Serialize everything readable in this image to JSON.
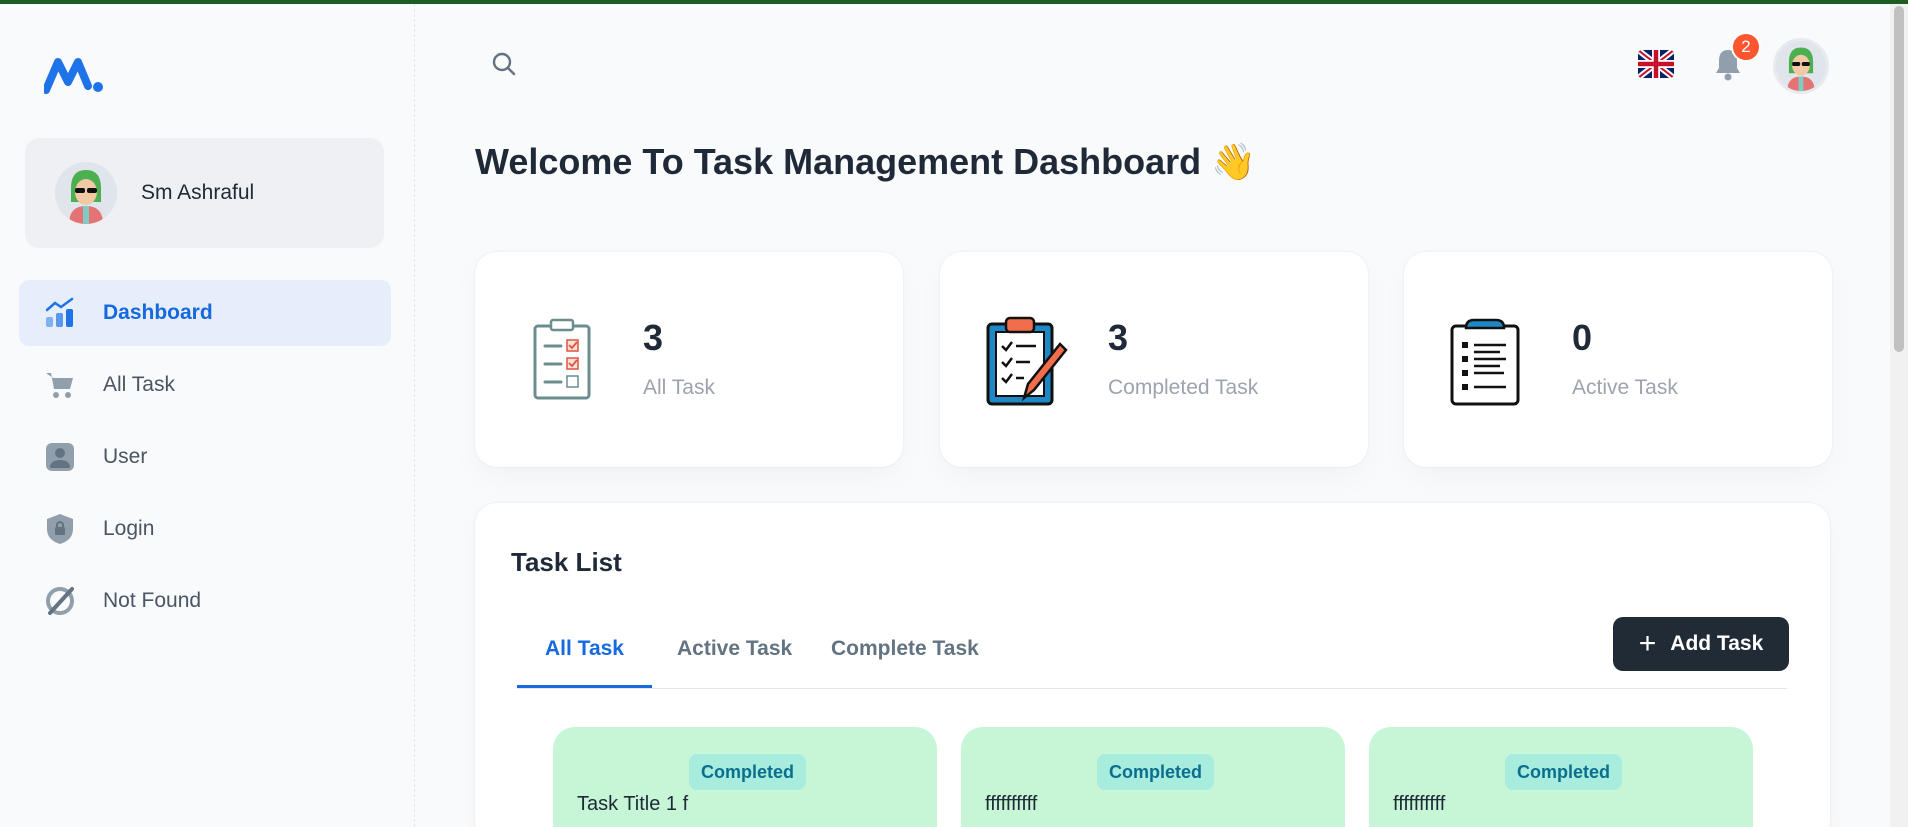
{
  "sidebar": {
    "user_name": "Sm Ashraful",
    "items": [
      {
        "label": "Dashboard",
        "icon": "chart-icon"
      },
      {
        "label": "All Task",
        "icon": "cart-icon"
      },
      {
        "label": "User",
        "icon": "user-icon"
      },
      {
        "label": "Login",
        "icon": "lock-icon"
      },
      {
        "label": "Not Found",
        "icon": "slash-icon"
      }
    ]
  },
  "header": {
    "notification_count": "2",
    "language_icon": "uk-flag-icon"
  },
  "main": {
    "welcome": "Welcome To Task Management Dashboard 👋",
    "stats": [
      {
        "value": "3",
        "label": "All Task"
      },
      {
        "value": "3",
        "label": "Completed Task"
      },
      {
        "value": "0",
        "label": "Active Task"
      }
    ],
    "task_list": {
      "title": "Task List",
      "tabs": [
        "All Task",
        "Active Task",
        "Complete Task"
      ],
      "add_label": "Add Task",
      "tasks": [
        {
          "status": "Completed",
          "title": "Task Title 1 f"
        },
        {
          "status": "Completed",
          "title": "ffffffffff"
        },
        {
          "status": "Completed",
          "title": "ffffffffff"
        }
      ]
    }
  },
  "colors": {
    "accent": "#1769e0",
    "completed_card": "#c6f6d5",
    "badge": "#ff5630",
    "dark_button": "#212b36"
  }
}
